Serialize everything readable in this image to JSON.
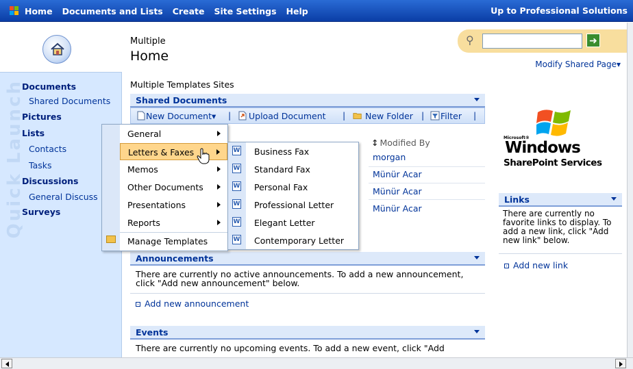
{
  "topnav": {
    "items": [
      "Home",
      "Documents and Lists",
      "Create",
      "Site Settings",
      "Help"
    ],
    "right_link": "Up to Professional Solutions"
  },
  "header": {
    "subtitle": "Multiple",
    "title": "Home",
    "modify_link": "Modify Shared Page▾",
    "search_placeholder": ""
  },
  "quick_launch": {
    "watermark": "Quick Launch",
    "items": [
      {
        "label": "Documents",
        "type": "head"
      },
      {
        "label": "Shared Documents",
        "type": "sub"
      },
      {
        "label": "Pictures",
        "type": "head"
      },
      {
        "label": "Lists",
        "type": "head"
      },
      {
        "label": "Contacts",
        "type": "sub"
      },
      {
        "label": "Tasks",
        "type": "sub"
      },
      {
        "label": "Discussions",
        "type": "head"
      },
      {
        "label": "General Discuss",
        "type": "sub"
      },
      {
        "label": "Surveys",
        "type": "head"
      }
    ]
  },
  "main": {
    "section_title": "Multiple Templates Sites",
    "shared_docs": {
      "title": "Shared Documents",
      "toolbar": {
        "new_document": "New Document▾",
        "upload": "Upload Document",
        "new_folder": "New Folder",
        "filter": "Filter"
      },
      "column_modified_by": "Modified By",
      "modified_by_values": [
        "morgan",
        "Münür Acar",
        "Münür Acar",
        "Münür Acar"
      ]
    },
    "announcements": {
      "title": "Announcements",
      "text": "There are currently no active announcements. To add a new announcement, click \"Add new announcement\" below.",
      "add_link": "Add new announcement"
    },
    "events": {
      "title": "Events",
      "text": "There are currently no upcoming events. To add a new event, click \"Add"
    }
  },
  "right": {
    "logo": {
      "microsoft": "Microsoft®",
      "windows": "Windows",
      "product": "SharePoint Services"
    },
    "links": {
      "title": "Links",
      "text": "There are currently no favorite links to display. To add a new link, click \"Add new link\" below.",
      "add_link": "Add new link"
    }
  },
  "new_document_menu": {
    "items": [
      "General",
      "Letters & Faxes",
      "Memos",
      "Other Documents",
      "Presentations",
      "Reports",
      "Manage Templates"
    ],
    "highlighted": "Letters & Faxes"
  },
  "letters_submenu": {
    "items": [
      "Business Fax",
      "Standard Fax",
      "Personal Fax",
      "Professional Letter",
      "Elegant Letter",
      "Contemporary Letter"
    ]
  },
  "colors": {
    "topbar": "#0b3ea6",
    "quick_launch_bg": "#d6e8ff",
    "link": "#003399",
    "menu_highlight": "#ffd68c"
  }
}
